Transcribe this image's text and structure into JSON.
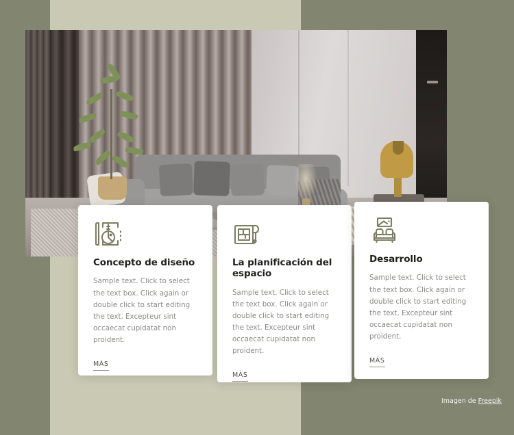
{
  "theme": {
    "background_outer": "#82856f",
    "background_inner": "#c9c9b4",
    "card_background": "#ffffff",
    "icon_color": "#7b7e62",
    "title_color": "#22211f",
    "body_color": "#8a8986",
    "link_color": "#4e4d4a"
  },
  "hero": {
    "alt": "Modern living room with grey sectional sofa, slatted wall, plant and brass lamp"
  },
  "cards": [
    {
      "icon": "drafting-compass-icon",
      "title": "Concepto de diseño",
      "body": "Sample text. Click to select the text box. Click again or double click to start editing the text. Excepteur sint occaecat cupidatat non proident.",
      "link_label": "MÁS"
    },
    {
      "icon": "blueprint-roll-icon",
      "title": "La planificación del espacio",
      "body": "Sample text. Click to select the text box. Click again or double click to start editing the text. Excepteur sint occaecat cupidatat non proident.",
      "link_label": "MÁS"
    },
    {
      "icon": "sofa-picture-icon",
      "title": "Desarrollo",
      "body": "Sample text. Click to select the text box. Click again or double click to start editing the text. Excepteur sint occaecat cupidatat non proident.",
      "link_label": "MÁS"
    }
  ],
  "attribution": {
    "prefix": "Imagen de ",
    "link_label": "Freepik"
  }
}
